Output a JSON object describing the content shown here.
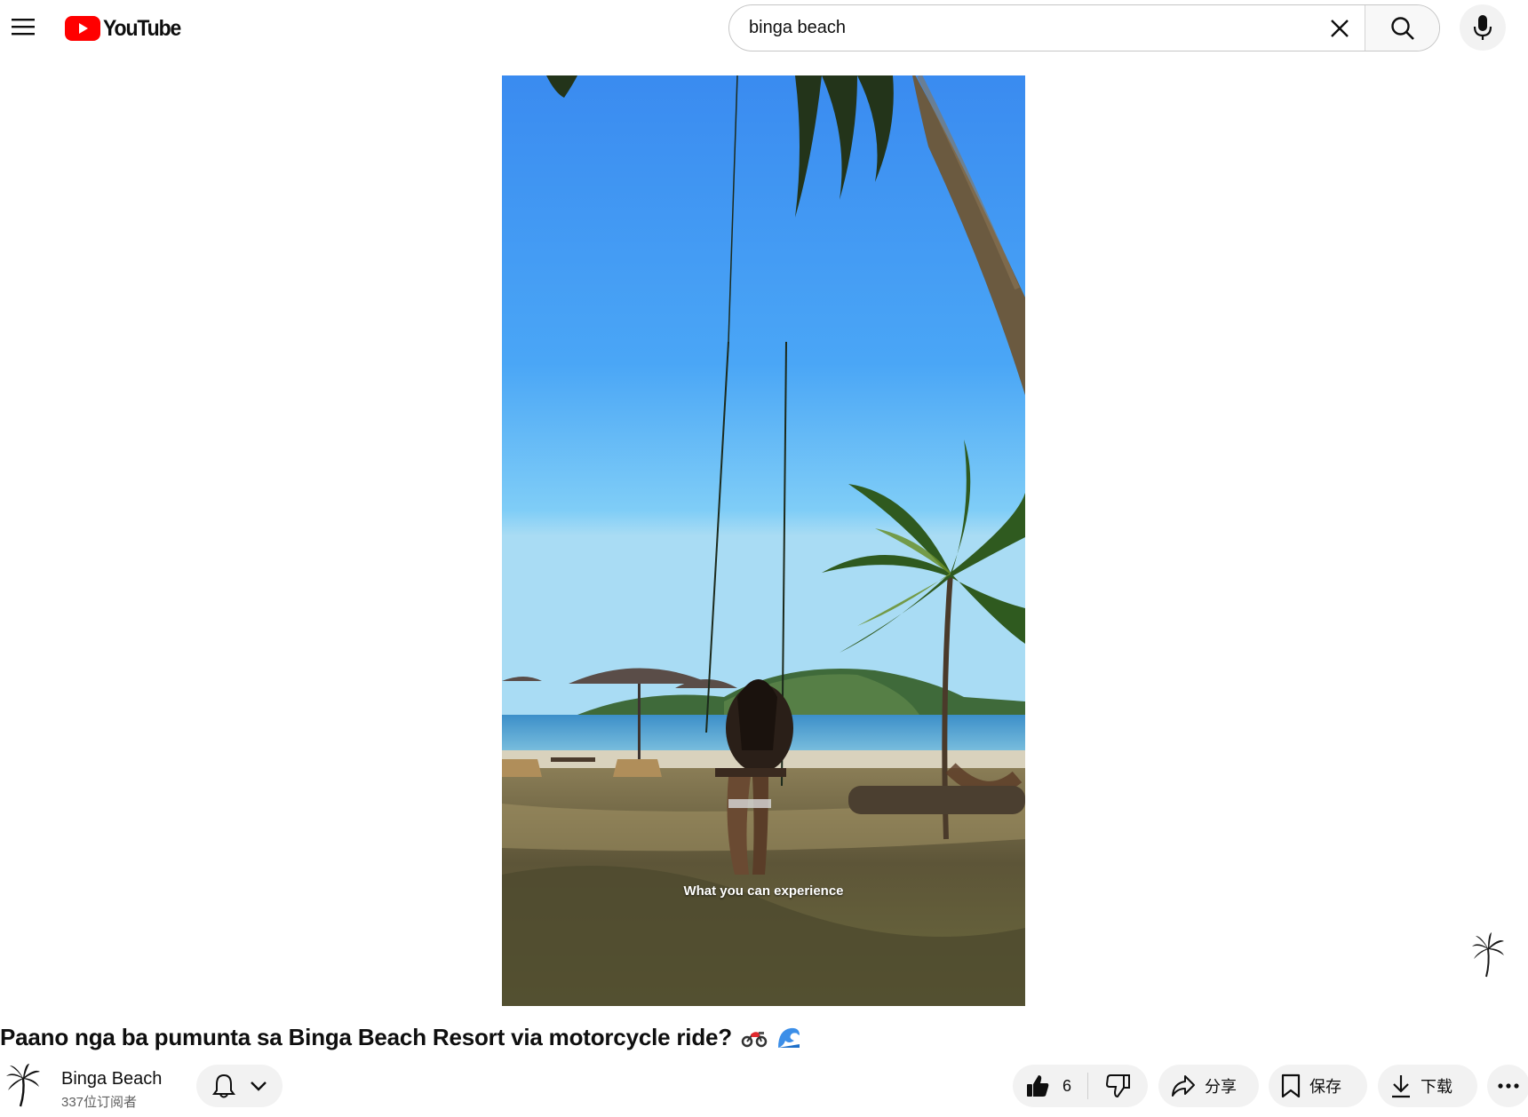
{
  "masthead": {
    "menu_icon": "hamburger-menu-icon",
    "logo_text": "YouTube",
    "brand_color": "#ff0000",
    "search": {
      "value": "binga beach",
      "clear_icon": "close-icon",
      "search_icon": "search-icon"
    },
    "mic_icon": "microphone-icon"
  },
  "player": {
    "caption": "What you can experience"
  },
  "video": {
    "title": "Paano nga ba pumunta sa Binga Beach Resort via motorcycle ride?",
    "title_emojis": [
      "motorcycle-emoji",
      "wave-emoji"
    ]
  },
  "owner": {
    "channel_name": "Binga Beach",
    "subscribers": "337位订阅者",
    "bell_icon": "bell-icon",
    "chevron_icon": "chevron-down-icon"
  },
  "actions": {
    "like_count": "6",
    "share_label": "分享",
    "save_label": "保存",
    "download_label": "下载",
    "more_icon": "more-horiz-icon"
  }
}
